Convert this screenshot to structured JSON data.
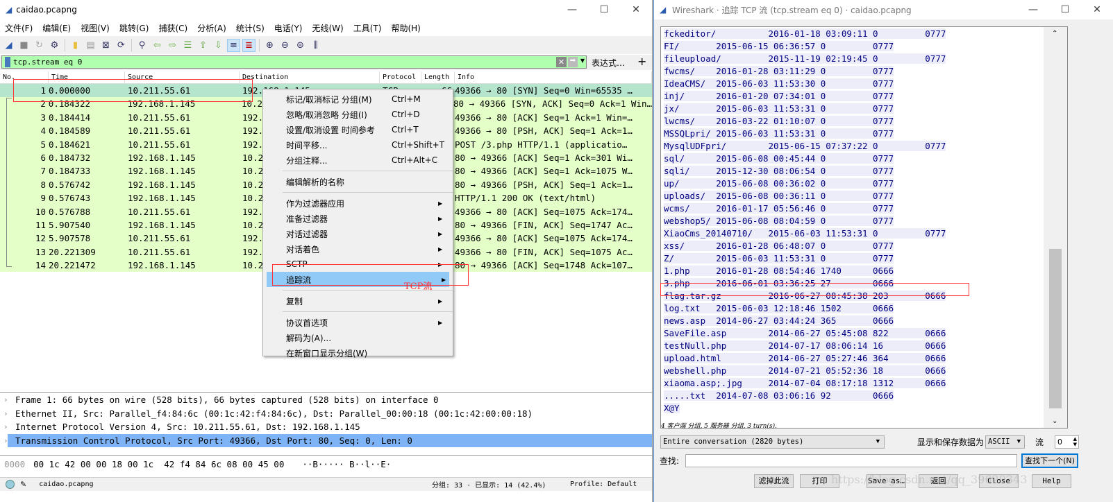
{
  "main": {
    "title": "caidao.pcapng",
    "menu": [
      "文件(F)",
      "编辑(E)",
      "视图(V)",
      "跳转(G)",
      "捕获(C)",
      "分析(A)",
      "统计(S)",
      "电话(Y)",
      "无线(W)",
      "工具(T)",
      "帮助(H)"
    ],
    "filter": {
      "value": "tcp.stream eq 0",
      "expression_label": "表达式…",
      "add_label": "+"
    },
    "columns": [
      "No.",
      "Time",
      "Source",
      "Destination",
      "Protocol",
      "Length",
      "Info"
    ],
    "packets": [
      {
        "no": "1",
        "time": "0.000000",
        "src": "10.211.55.61",
        "dst": "192.168.1.145",
        "proto": "TCP",
        "len": "66",
        "info": "49366 → 80 [SYN] Seq=0 Win=65535 …"
      },
      {
        "no": "2",
        "time": "0.184322",
        "src": "192.168.1.145",
        "dst": "10.211.55.61",
        "info": "80 → 49366 [SYN, ACK] Seq=0 Ack=1 Win…"
      },
      {
        "no": "3",
        "time": "0.184414",
        "src": "10.211.55.61",
        "dst": "192.168.1.145",
        "info": "49366 → 80 [ACK] Seq=1 Ack=1 Win=…"
      },
      {
        "no": "4",
        "time": "0.184589",
        "src": "10.211.55.61",
        "dst": "192.168.1.145",
        "info": "49366 → 80 [PSH, ACK] Seq=1 Ack=1…"
      },
      {
        "no": "5",
        "time": "0.184621",
        "src": "10.211.55.61",
        "dst": "192.168.1.145",
        "info": "POST /3.php HTTP/1.1  (applicatio…"
      },
      {
        "no": "6",
        "time": "0.184732",
        "src": "192.168.1.145",
        "dst": "10.211.55.61",
        "info": "80 → 49366 [ACK] Seq=1 Ack=301 Wi…"
      },
      {
        "no": "7",
        "time": "0.184733",
        "src": "192.168.1.145",
        "dst": "10.211.55.61",
        "info": "80 → 49366 [ACK] Seq=1 Ack=1075 W…"
      },
      {
        "no": "8",
        "time": "0.576742",
        "src": "192.168.1.145",
        "dst": "10.211.55.61",
        "info": "80 → 49366 [PSH, ACK] Seq=1 Ack=1…"
      },
      {
        "no": "9",
        "time": "0.576743",
        "src": "192.168.1.145",
        "dst": "10.211.55.61",
        "info": "HTTP/1.1 200 OK  (text/html)"
      },
      {
        "no": "10",
        "time": "0.576788",
        "src": "10.211.55.61",
        "dst": "192.168.1.145",
        "info": "49366 → 80 [ACK] Seq=1075 Ack=174…"
      },
      {
        "no": "11",
        "time": "5.907540",
        "src": "192.168.1.145",
        "dst": "10.211.55.61",
        "info": "80 → 49366 [FIN, ACK] Seq=1747 Ac…"
      },
      {
        "no": "12",
        "time": "5.907578",
        "src": "10.211.55.61",
        "dst": "192.168.1.145",
        "info": "49366 → 80 [ACK] Seq=1075 Ack=174…"
      },
      {
        "no": "13",
        "time": "20.221309",
        "src": "10.211.55.61",
        "dst": "192.168.1.145",
        "info": "49366 → 80 [FIN, ACK] Seq=1075 Ac…"
      },
      {
        "no": "14",
        "time": "20.221472",
        "src": "192.168.1.145",
        "dst": "10.211.55.61",
        "info": "80 → 49366 [ACK] Seq=1748 Ack=107…"
      }
    ],
    "context_menu": [
      {
        "label": "标记/取消标记 分组(M)",
        "shortcut": "Ctrl+M"
      },
      {
        "label": "忽略/取消忽略 分组(I)",
        "shortcut": "Ctrl+D"
      },
      {
        "label": "设置/取消设置 时间参考",
        "shortcut": "Ctrl+T"
      },
      {
        "label": "时间平移...",
        "shortcut": "Ctrl+Shift+T"
      },
      {
        "label": "分组注释...",
        "shortcut": "Ctrl+Alt+C"
      },
      {
        "label": "编辑解析的名称"
      },
      {
        "label": "作为过滤器应用",
        "submenu": true
      },
      {
        "label": "准备过滤器",
        "submenu": true
      },
      {
        "label": "对话过滤器",
        "submenu": true
      },
      {
        "label": "对话着色",
        "submenu": true
      },
      {
        "label": "SCTP",
        "submenu": true
      },
      {
        "label": "追踪流",
        "submenu": true,
        "highlighted": true
      },
      {
        "label": "复制",
        "submenu": true
      },
      {
        "label": "协议首选项",
        "submenu": true
      },
      {
        "label": "解码为(A)..."
      },
      {
        "label": "在新窗口显示分组(W)"
      }
    ],
    "annotation": "TCP流",
    "details": [
      "Frame 1: 66 bytes on wire (528 bits), 66 bytes captured (528 bits) on interface 0",
      "Ethernet II, Src: Parallel_f4:84:6c (00:1c:42:f4:84:6c), Dst: Parallel_00:00:18 (00:1c:42:00:00:18)",
      "Internet Protocol Version 4, Src: 10.211.55.61, Dst: 192.168.1.145",
      "Transmission Control Protocol, Src Port: 49366, Dst Port: 80, Seq: 0, Len: 0"
    ],
    "hex": {
      "offset": "0000",
      "bytes": "00 1c 42 00 00 18 00 1c  42 f4 84 6c 08 00 45 00",
      "ascii": "··B····· B··l··E·"
    },
    "status": {
      "file": "caidao.pcapng",
      "packets": "分组: 33 · 已显示: 14 (42.4%)",
      "profile": "Profile: Default"
    },
    "colors": {
      "row": "#e4ffc7",
      "row_selected": "#b5e6cd",
      "filter_bg": "#afffaf",
      "highlight": "#91c9f7"
    }
  },
  "follow": {
    "title": "Wireshark · 追踪 TCP 流 (tcp.stream eq 0) · caidao.pcapng",
    "lines": [
      "fckeditor/          2016-01-18 03:09:11 0         0777",
      "FI/       2015-06-15 06:36:57 0         0777",
      "fileupload/         2015-11-19 02:19:45 0         0777",
      "fwcms/    2016-01-28 03:11:29 0         0777",
      "IdeaCMS/  2015-06-03 11:53:30 0         0777",
      "inj/      2016-01-20 07:34:01 0         0777",
      "jx/       2015-06-03 11:53:31 0         0777",
      "lwcms/    2016-03-22 01:10:07 0         0777",
      "MSSQLpri/ 2015-06-03 11:53:31 0         0777",
      "MysqlUDFpri/        2015-06-15 07:37:22 0         0777",
      "sql/      2015-06-08 00:45:44 0         0777",
      "sqli/     2015-12-30 08:06:54 0         0777",
      "up/       2015-06-08 00:36:02 0         0777",
      "uploads/  2015-06-08 00:36:11 0         0777",
      "wcms/     2016-01-17 05:56:46 0         0777",
      "webshop5/ 2015-06-08 08:04:59 0         0777",
      "XiaoCms_20140710/   2015-06-03 11:53:31 0         0777",
      "xss/      2016-01-28 06:48:07 0         0777",
      "Z/        2015-06-03 11:53:31 0         0777",
      "1.php     2016-01-28 08:54:46 1740      0666",
      "3.php     2016-06-01 03:36:25 27        0666",
      "flag.tar.gz         2016-06-27 08:45:38 203       0666",
      "log.txt   2015-06-03 12:18:46 1502      0666",
      "news.asp  2014-06-27 03:44:24 365       0666",
      "SaveFile.asp        2014-06-27 05:45:08 822       0666",
      "testNull.php        2014-07-17 08:06:14 16        0666",
      "upload.html         2014-06-27 05:27:46 364       0666",
      "webshell.php        2014-07-21 05:52:36 18        0666",
      "xiaoma.asp;.jpg     2014-07-04 08:17:18 1312      0666",
      ".....txt  2014-07-08 03:06:16 92        0666",
      "X@Y"
    ],
    "summary": "4 客户端 分组, 5 服务器 分组, 3 turn(s).",
    "conversation": "Entire conversation (2820 bytes)",
    "show_as_label": "显示和保存数据为",
    "show_as": "ASCII",
    "stream_label": "流",
    "stream": "0",
    "find_label": "查找:",
    "find_value": "",
    "find_next": "查找下一个(N)",
    "buttons": [
      "滤掉此流",
      "打印",
      "Save as…",
      "返回",
      "Close",
      "Help"
    ],
    "watermark": "https://blog.csdn.net/qq_39629343"
  }
}
